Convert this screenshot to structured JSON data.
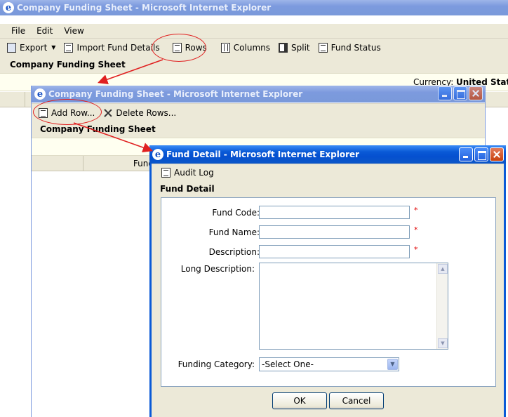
{
  "win1": {
    "title": "Company Funding Sheet - Microsoft Internet Explorer",
    "menu": [
      "File",
      "Edit",
      "View"
    ],
    "toolbar": {
      "export": "Export",
      "import": "Import Fund Details",
      "rows": "Rows",
      "columns": "Columns",
      "split": "Split",
      "fund_status": "Fund Status"
    },
    "section_title": "Company Funding Sheet",
    "currency_label": "Currency:",
    "currency_value": "United States"
  },
  "win2": {
    "title": "Company Funding Sheet - Microsoft Internet Explorer",
    "toolbar": {
      "add_row": "Add Row...",
      "delete_rows": "Delete Rows..."
    },
    "section_title": "Company Funding Sheet",
    "column_partial": "Fund"
  },
  "win3": {
    "title": "Fund Detail - Microsoft Internet Explorer",
    "toolbar": {
      "audit_log": "Audit Log"
    },
    "section_title": "Fund Detail",
    "form": {
      "fund_code_label": "Fund Code:",
      "fund_code_value": "",
      "fund_name_label": "Fund Name:",
      "fund_name_value": "",
      "description_label": "Description:",
      "description_value": "",
      "long_description_label": "Long Description:",
      "long_description_value": "",
      "funding_category_label": "Funding Category:",
      "funding_category_selected": "-Select One-",
      "required_mark": "*"
    },
    "buttons": {
      "ok": "OK",
      "cancel": "Cancel"
    }
  },
  "colors": {
    "title_active": "#0a5ad7",
    "title_inactive": "#7c9ade",
    "chrome": "#ece9d8",
    "annotation": "#e02020",
    "required": "#e00000"
  }
}
